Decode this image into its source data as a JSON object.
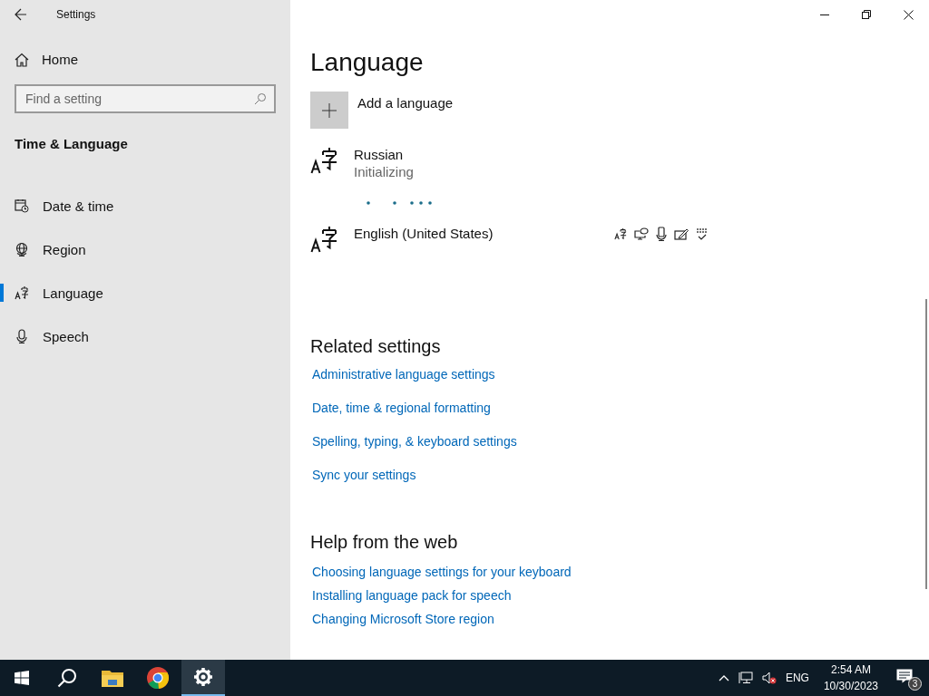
{
  "window": {
    "title": "Settings"
  },
  "sidebar": {
    "home": "Home",
    "search": {
      "placeholder": "Find a setting"
    },
    "section": "Time & Language",
    "items": [
      {
        "label": "Date & time",
        "kind": "calendar",
        "selected": false
      },
      {
        "label": "Region",
        "kind": "globe",
        "selected": false
      },
      {
        "label": "Language",
        "kind": "language",
        "selected": true
      },
      {
        "label": "Speech",
        "kind": "microphone",
        "selected": false
      }
    ]
  },
  "content": {
    "title": "Language",
    "add_language": "Add a language",
    "languages": [
      {
        "name": "Russian",
        "status": "Initializing",
        "kind": "installing"
      },
      {
        "name": "English (United States)",
        "kind": "installed"
      }
    ],
    "related": {
      "title": "Related settings",
      "links": [
        "Administrative language settings",
        "Date, time & regional formatting",
        "Spelling, typing, & keyboard settings",
        "Sync your settings"
      ]
    },
    "help": {
      "title": "Help from the web",
      "links": [
        "Choosing language settings for your keyboard",
        "Installing language pack for speech",
        "Changing Microsoft Store region"
      ]
    }
  },
  "taskbar": {
    "apps": [
      {
        "kind": "start",
        "selected": false
      },
      {
        "kind": "search",
        "selected": false
      },
      {
        "kind": "folder",
        "selected": false
      },
      {
        "kind": "browser",
        "selected": false
      },
      {
        "kind": "settings",
        "selected": true
      }
    ],
    "tray": {
      "volume": {
        "muted": true
      },
      "language": "ENG",
      "time": "2:54 AM",
      "date": "10/30/2023",
      "notifications": "3"
    }
  }
}
